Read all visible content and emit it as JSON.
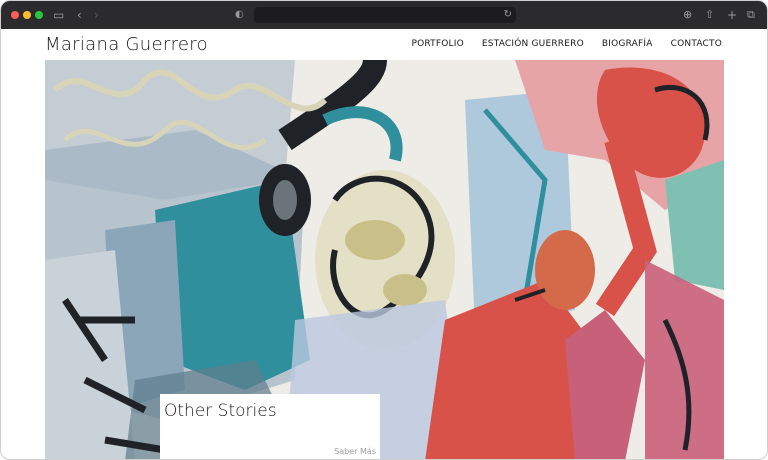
{
  "browser": {
    "icons": [
      "sidebar-icon",
      "back-icon",
      "forward-icon",
      "shield-icon",
      "reload-icon",
      "download-icon",
      "share-icon",
      "new-tab-icon",
      "tabs-overview-icon"
    ]
  },
  "site": {
    "title": "Mariana Guerrero",
    "nav": [
      "PORTFOLIO",
      "ESTACIÓN GUERRERO",
      "BIOGRAFÍA",
      "CONTACTO"
    ]
  },
  "feature": {
    "title": "Other Stories",
    "link": "Saber Más"
  },
  "colors": {
    "chrome": "#2b2b2d",
    "teal": "#2f8f9d",
    "red": "#d8524a",
    "pink": "#c9607a",
    "text": "#1a1a1a"
  }
}
